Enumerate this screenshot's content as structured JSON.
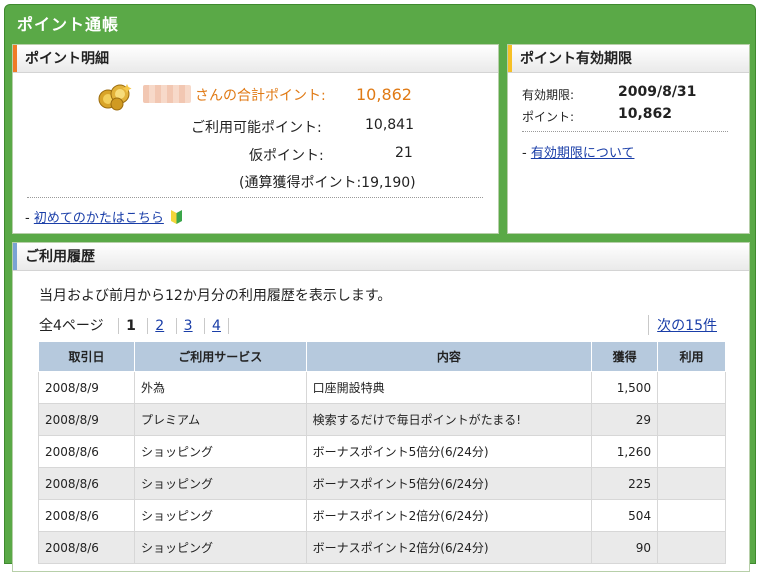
{
  "window": {
    "title": "ポイント通帳"
  },
  "detail": {
    "header": "ポイント明細",
    "total_label": "さんの合計ポイント:",
    "total_value": "10,862",
    "available_label": "ご利用可能ポイント:",
    "available_value": "10,841",
    "temp_label": "仮ポイント:",
    "temp_value": "21",
    "cumulative": "(通算獲得ポイント:19,190)",
    "first_link": "初めてのかたはこちら",
    "link_prefix": "-"
  },
  "expiry": {
    "header": "ポイント有効期限",
    "date_label": "有効期限:",
    "date_value": "2009/8/31",
    "points_label": "ポイント:",
    "points_value": "10,862",
    "link_prefix": "-",
    "about_link": "有効期限について"
  },
  "history": {
    "header": "ご利用履歴",
    "intro": "当月および前月から12か月分の利用履歴を表示します。",
    "total_pages": "全4ページ",
    "pages": [
      "1",
      "2",
      "3",
      "4"
    ],
    "next_link": "次の15件",
    "columns": [
      "取引日",
      "ご利用サービス",
      "内容",
      "獲得",
      "利用"
    ],
    "rows": [
      [
        "2008/8/9",
        "外為",
        "口座開設特典",
        "1,500",
        ""
      ],
      [
        "2008/8/9",
        "プレミアム",
        "検索するだけで毎日ポイントがたまる!",
        "29",
        ""
      ],
      [
        "2008/8/6",
        "ショッピング",
        "ボーナスポイント5倍分(6/24分)",
        "1,260",
        ""
      ],
      [
        "2008/8/6",
        "ショッピング",
        "ボーナスポイント5倍分(6/24分)",
        "225",
        ""
      ],
      [
        "2008/8/6",
        "ショッピング",
        "ボーナスポイント2倍分(6/24分)",
        "504",
        ""
      ],
      [
        "2008/8/6",
        "ショッピング",
        "ボーナスポイント2倍分(6/24分)",
        "90",
        ""
      ]
    ]
  },
  "colors": {
    "frame_green": "#5aa947",
    "accent_orange": "#f07b27",
    "accent_yellow": "#f6c026",
    "accent_blue": "#7aa3d4",
    "table_header": "#b6c9dd",
    "link_blue": "#1a3ea8"
  },
  "icons": [
    "coins-icon",
    "beginner-mark-icon"
  ]
}
